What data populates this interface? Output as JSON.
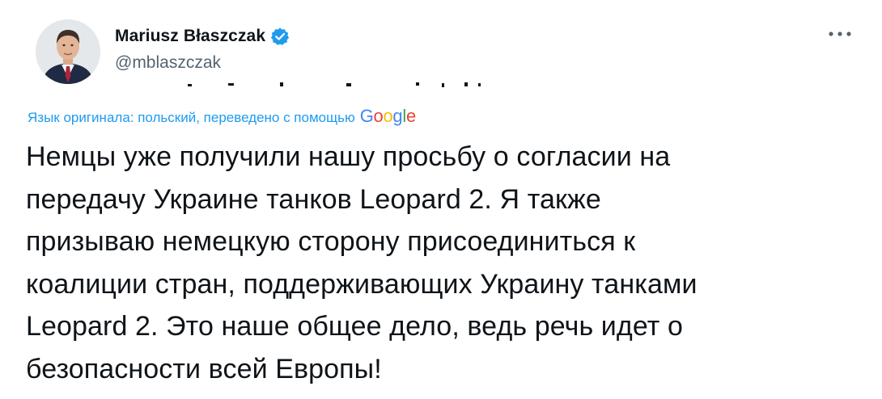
{
  "author": {
    "display_name": "Mariusz Błaszczak",
    "handle": "@mblaszczak",
    "verified": true,
    "avatar_icon": "avatar-photo"
  },
  "actions": {
    "more_icon": "more-dots-icon"
  },
  "translation": {
    "label": "Язык оригинала: польский, переведено с помощью",
    "provider": [
      "G",
      "o",
      "o",
      "g",
      "l",
      "e"
    ],
    "provider_colors": [
      "#4285f4",
      "#ea4335",
      "#fbbc05",
      "#4285f4",
      "#34a853",
      "#ea4335"
    ],
    "link_color": "#1d9bf0"
  },
  "tweet": {
    "lines": [
      "Немцы уже получили нашу просьбу о согласии на",
      "передачу Украине танков Leopard 2. Я также",
      "призываю немецкую сторону присоединиться к",
      "коалиции стран, поддерживающих Украину танками",
      "Leopard 2. Это наше общее дело, ведь речь идет о",
      "безопасности всей Европы!"
    ]
  },
  "colors": {
    "text": "#0f1419",
    "secondary": "#536471",
    "verified": "#1d9bf0"
  }
}
